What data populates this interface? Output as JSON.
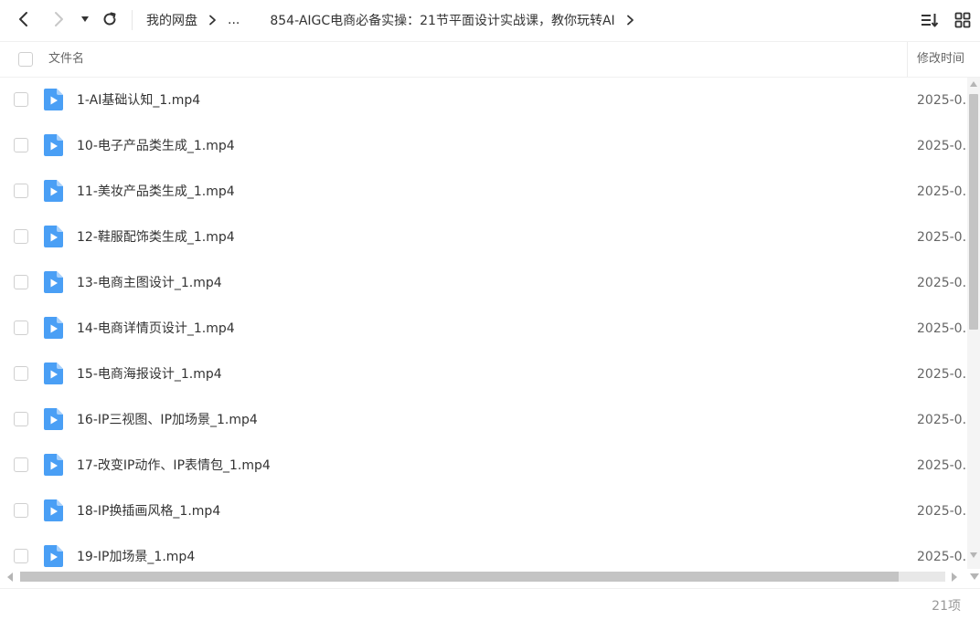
{
  "nav": {
    "back_icon": "chevron-left-icon",
    "forward_icon": "chevron-right-icon",
    "history_dropdown_icon": "caret-down-icon",
    "refresh_icon": "refresh-icon",
    "breadcrumb": {
      "root": "我的网盘",
      "ellipsis": "...",
      "current": "854-AIGC电商必备实操：21节平面设计实战课，教你玩转AI"
    },
    "sort_icon": "sort-icon",
    "grid_view_icon": "grid-view-icon"
  },
  "header": {
    "name": "文件名",
    "mtime": "修改时间"
  },
  "files": [
    {
      "name": "1-AI基础认知_1.mp4",
      "mtime": "2025-0..."
    },
    {
      "name": "10-电子产品类生成_1.mp4",
      "mtime": "2025-0..."
    },
    {
      "name": "11-美妆产品类生成_1.mp4",
      "mtime": "2025-0..."
    },
    {
      "name": "12-鞋服配饰类生成_1.mp4",
      "mtime": "2025-0..."
    },
    {
      "name": "13-电商主图设计_1.mp4",
      "mtime": "2025-0..."
    },
    {
      "name": "14-电商详情页设计_1.mp4",
      "mtime": "2025-0..."
    },
    {
      "name": "15-电商海报设计_1.mp4",
      "mtime": "2025-0..."
    },
    {
      "name": "16-IP三视图、IP加场景_1.mp4",
      "mtime": "2025-0..."
    },
    {
      "name": "17-改变IP动作、IP表情包_1.mp4",
      "mtime": "2025-0..."
    },
    {
      "name": "18-IP换插画风格_1.mp4",
      "mtime": "2025-0..."
    },
    {
      "name": "19-IP加场景_1.mp4",
      "mtime": "2025-0..."
    }
  ],
  "file_icon": "video-file-icon",
  "colors": {
    "accent": "#4a9ff5",
    "text": "#333333",
    "muted": "#999999"
  },
  "scroll": {
    "horizontal_visible_fraction": 0.95
  },
  "footer": {
    "count": "21项"
  }
}
